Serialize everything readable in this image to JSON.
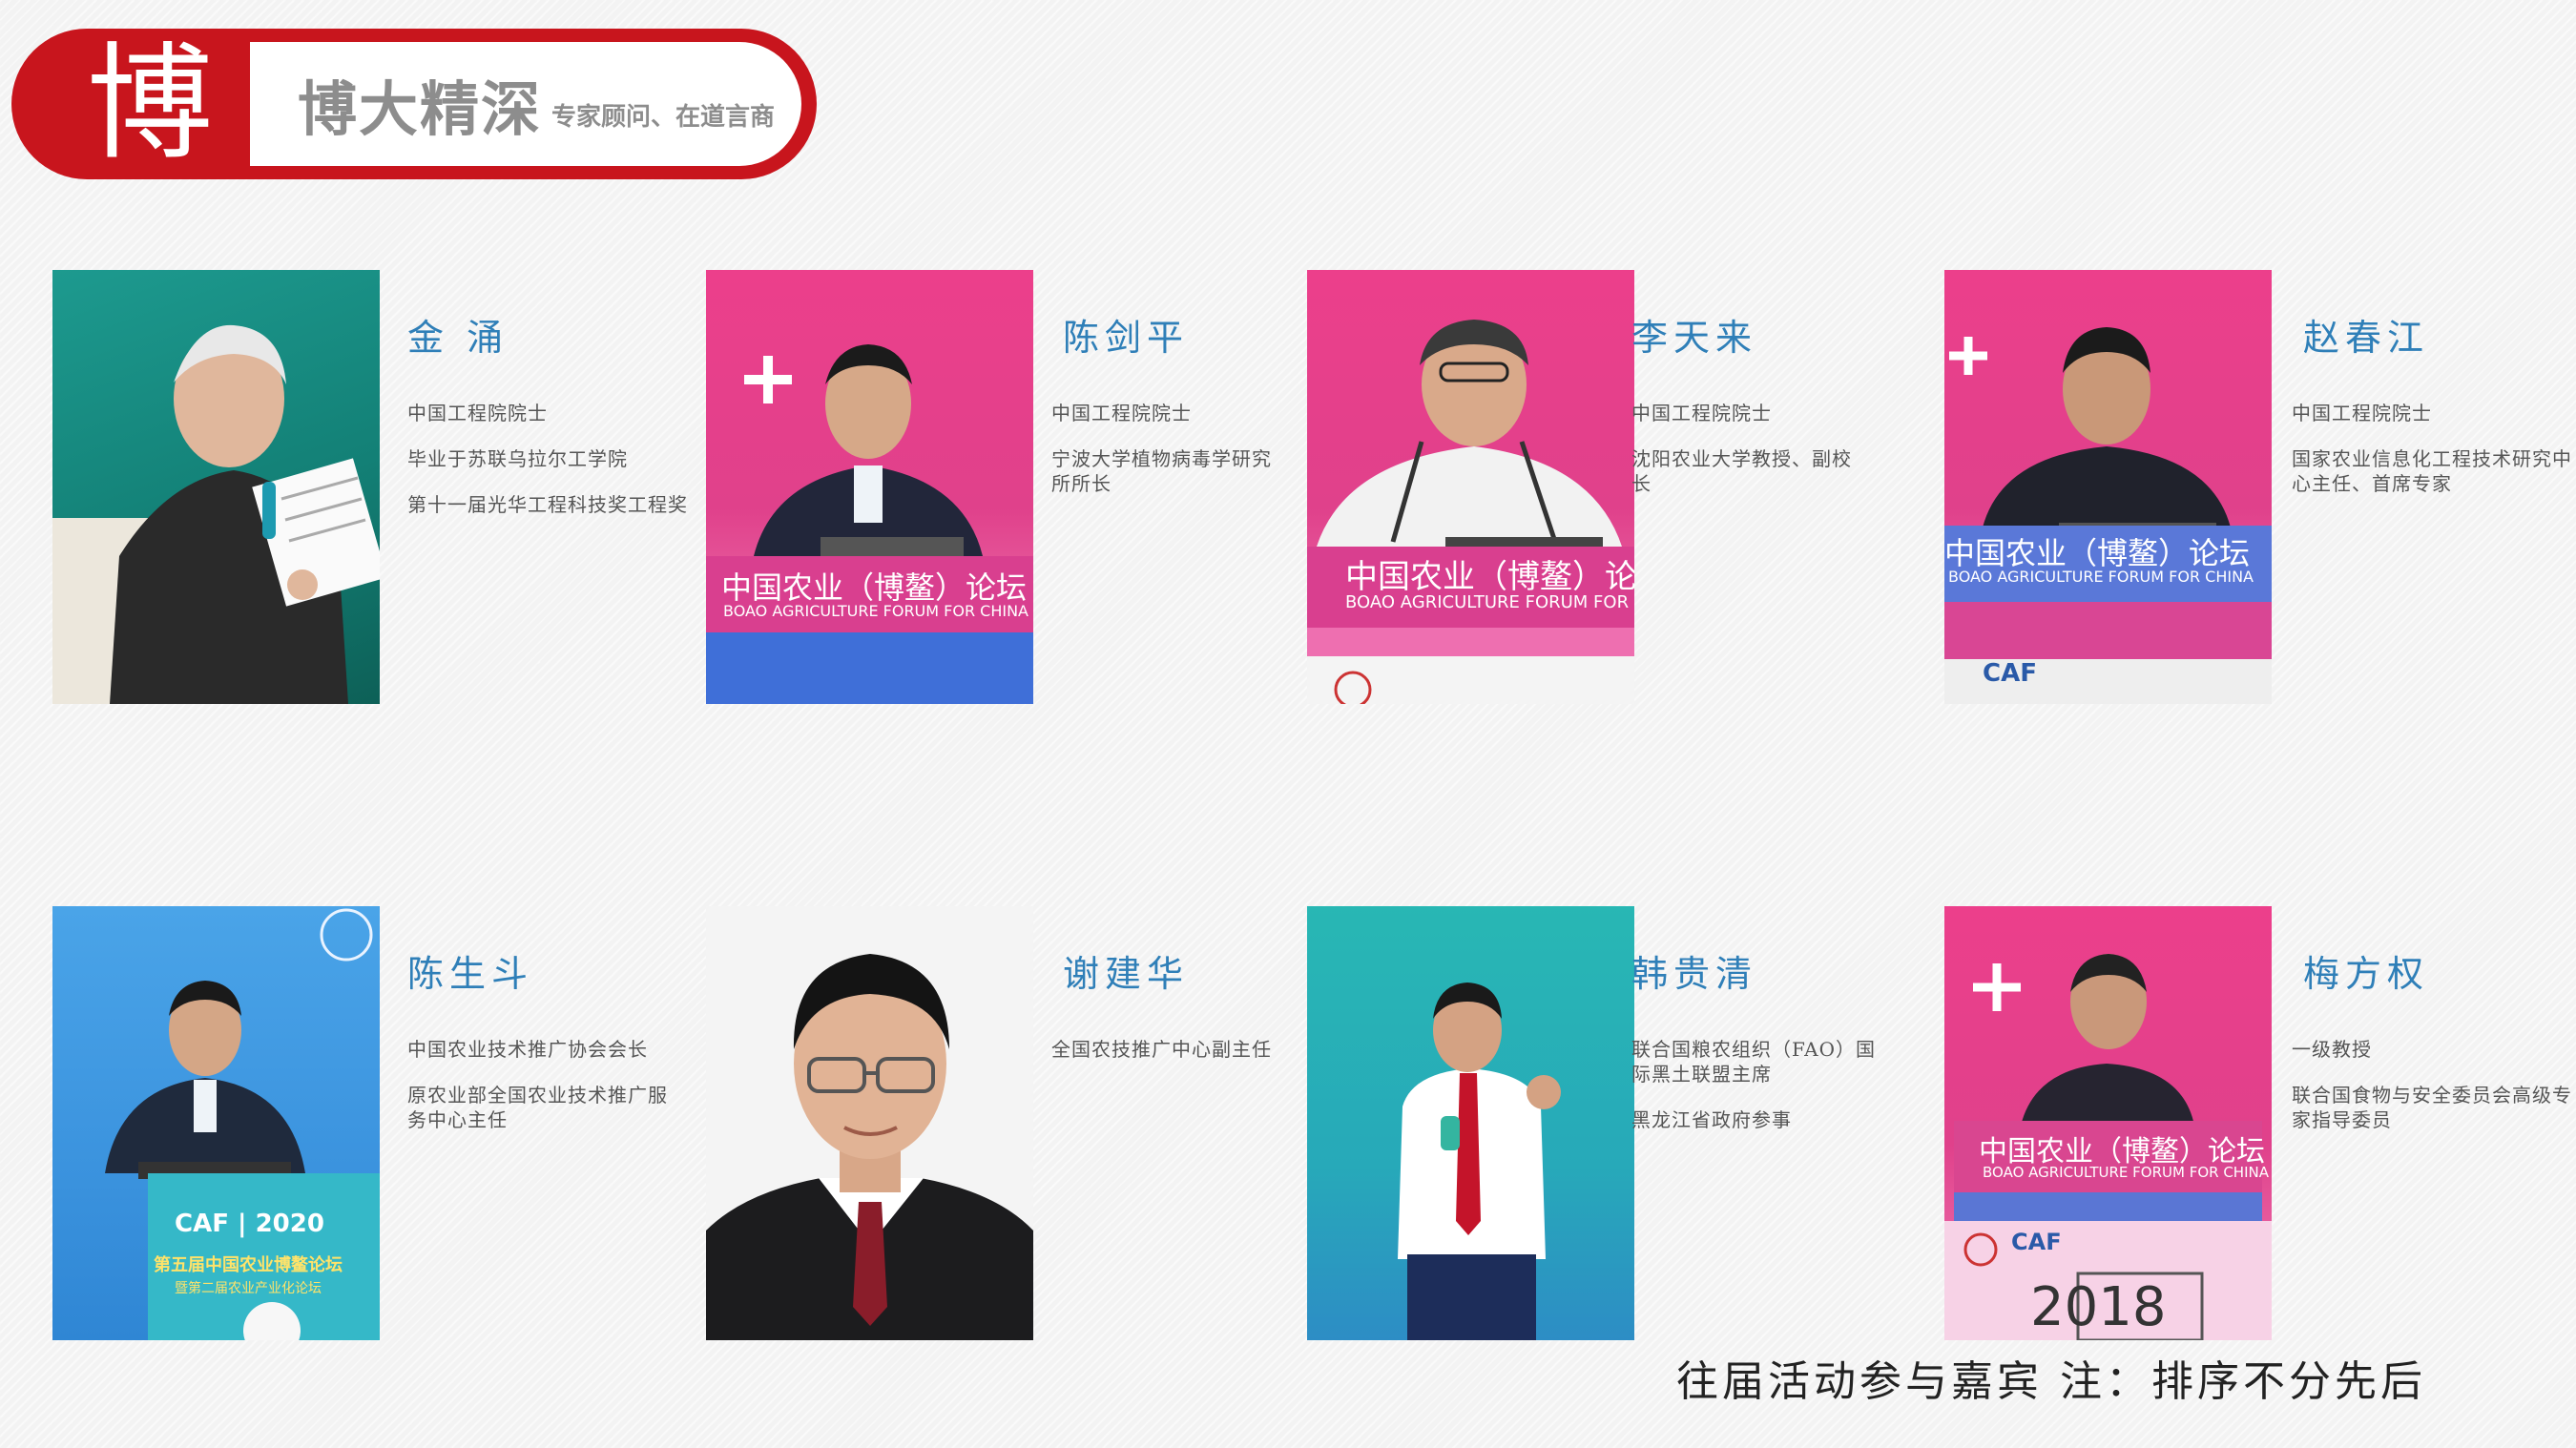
{
  "header": {
    "char": "博",
    "title": "博大精深",
    "subtitle": "专家顾问、在道言商"
  },
  "banner": {
    "cn": "中国农业（博鳌）论坛",
    "en": "BOAO AGRICULTURE FORUM FOR CHINA",
    "caf": "CAF",
    "caf_year": "2020",
    "forum5": "第五届中国农业博鳌论坛",
    "forum5_sub": "暨第二届农业产业化论坛",
    "year_2018": "2018"
  },
  "experts": [
    {
      "name": "金  涌",
      "lines": [
        "中国工程院院士",
        "毕业于苏联乌拉尔工学院",
        "第十一届光华工程科技奖工程奖"
      ]
    },
    {
      "name": "陈剑平",
      "lines": [
        "中国工程院院士",
        "宁波大学植物病毒学研究所所长"
      ]
    },
    {
      "name": "李天来",
      "lines": [
        "中国工程院院士",
        "沈阳农业大学教授、副校长"
      ]
    },
    {
      "name": "赵春江",
      "lines": [
        "中国工程院院士",
        "国家农业信息化工程技术研究中心主任、首席专家"
      ]
    },
    {
      "name": "陈生斗",
      "lines": [
        "中国农业技术推广协会会长",
        "原农业部全国农业技术推广服务中心主任"
      ]
    },
    {
      "name": "谢建华",
      "lines": [
        "全国农技推广中心副主任"
      ]
    },
    {
      "name": "韩贵清",
      "lines": [
        "联合国粮农组织（FAO）国际黑土联盟主席",
        "黑龙江省政府参事"
      ]
    },
    {
      "name": "梅方权",
      "lines": [
        "一级教授",
        "联合国食物与安全委员会高级专家指导委员"
      ]
    }
  ],
  "footer": "往届活动参与嘉宾 注：排序不分先后"
}
